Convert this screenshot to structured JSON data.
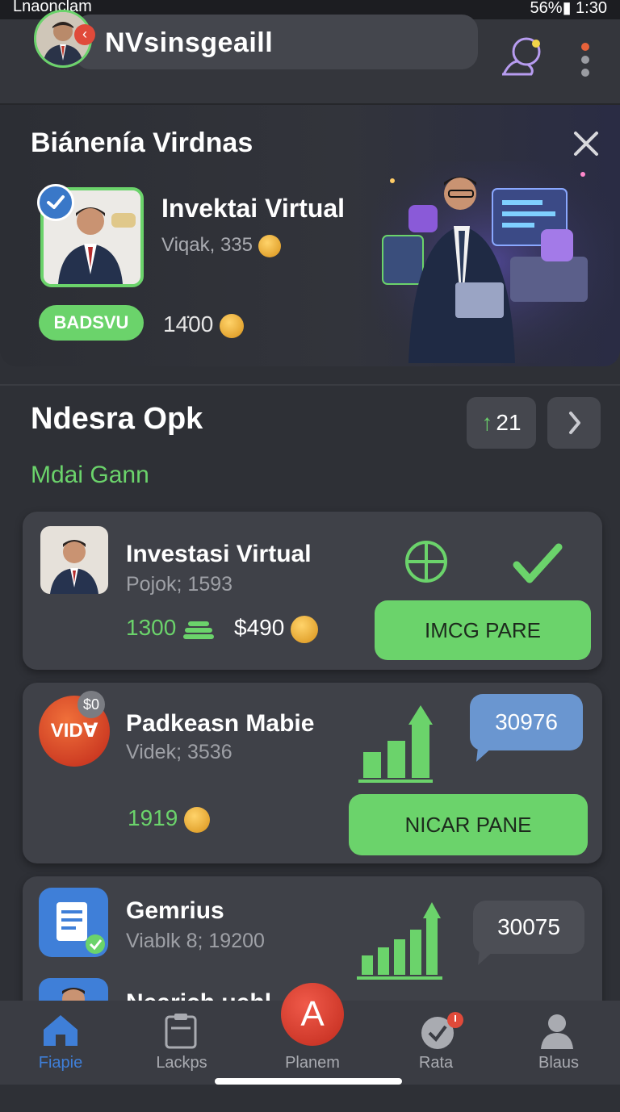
{
  "status_bar": {
    "left_text": "Lnaonclam",
    "right_text": "56%▮ 1:30"
  },
  "header": {
    "username": "NVsinsgeaill",
    "notif_glyph": "‹"
  },
  "banner": {
    "title": "Biáneníа Virdnas",
    "subtitle": "Invektai Virtual",
    "meta": "Viqak, 335",
    "badge": "BADSVU",
    "coins": "14̇00"
  },
  "section": {
    "title": "Ndesra Opk",
    "subtitle": "Mdai Gann",
    "counter_arrow": "↑",
    "counter": "21"
  },
  "cards": [
    {
      "title": "Investasi Virtual",
      "meta": "Pojok; 1593",
      "stat1": "1300",
      "stat2": "$490",
      "button": "IMCG PARE"
    },
    {
      "title": "Padkeasn Mabie",
      "meta": "Videk; 3536",
      "logo_text": "VIDⱯ",
      "logo_badge": "$0",
      "stat1": "1919",
      "bubble": "30976",
      "button": "NICAR PANE"
    },
    {
      "title": "Gemrius",
      "meta": "Viablk 8; 19200",
      "bubble": "30075"
    },
    {
      "title": "Nearich uehl"
    }
  ],
  "nav": [
    {
      "label": "Fiapie",
      "icon": "home-icon"
    },
    {
      "label": "Lackps",
      "icon": "clipboard-icon"
    },
    {
      "label": "Planem",
      "icon": "letter-a-icon",
      "center_glyph": "A"
    },
    {
      "label": "Rata",
      "icon": "badge-check-icon"
    },
    {
      "label": "Blaus",
      "icon": "person-icon"
    }
  ],
  "colors": {
    "accent": "#6bd36b",
    "background": "#2e3036",
    "card": "#3f4148",
    "bubble_blue": "#6a96d0",
    "bubble_gray": "#4c4e55",
    "alert_red": "#e04a3a"
  }
}
